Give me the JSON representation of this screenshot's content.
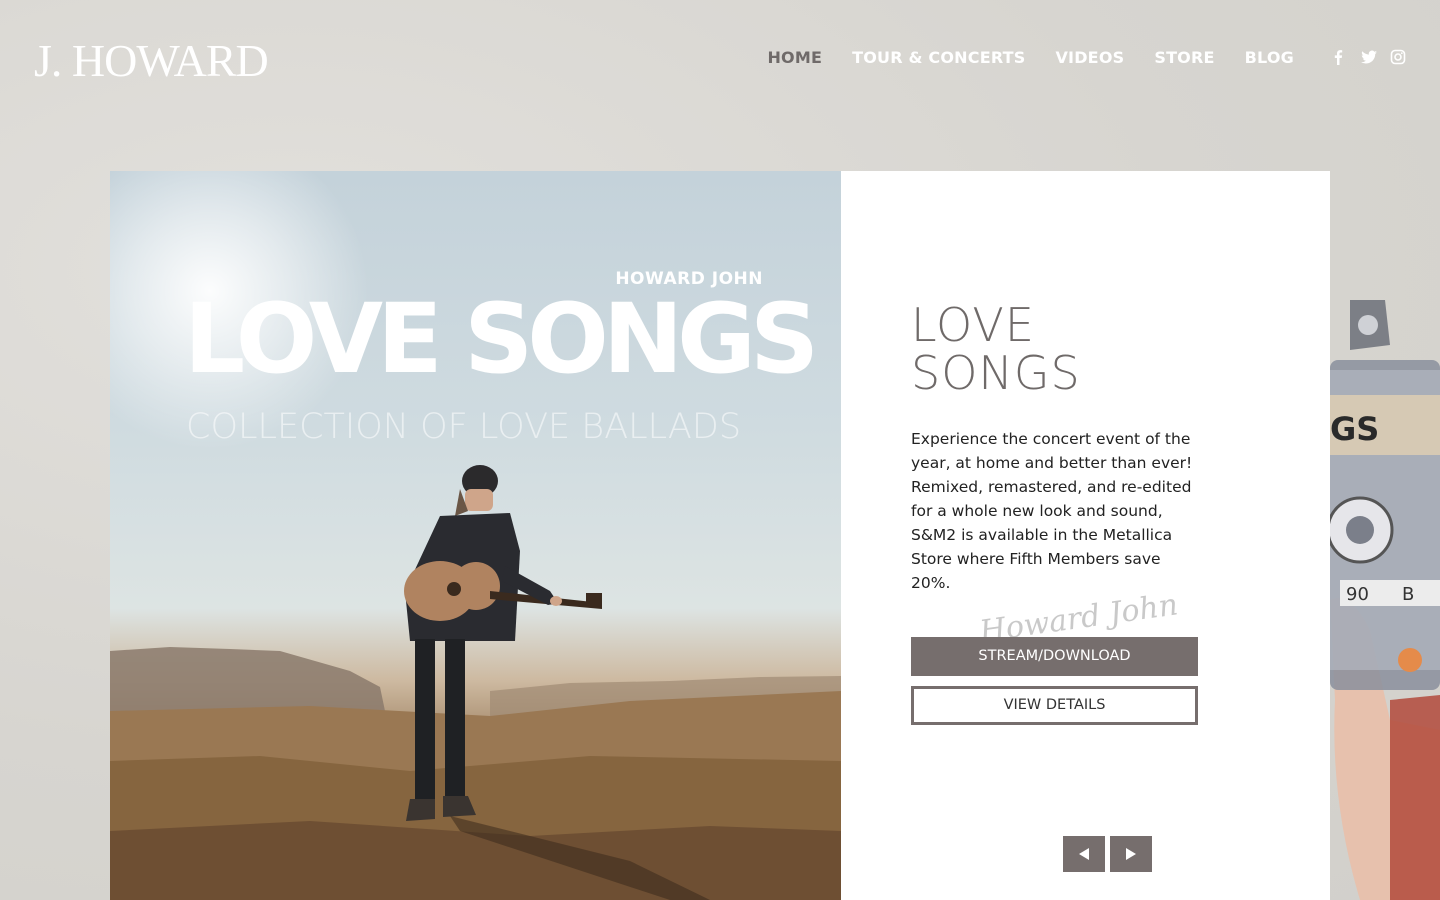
{
  "header": {
    "logo": "J. HOWARD",
    "nav": [
      {
        "label": "HOME",
        "active": true
      },
      {
        "label": "TOUR & CONCERTS",
        "active": false
      },
      {
        "label": "VIDEOS",
        "active": false
      },
      {
        "label": "STORE",
        "active": false
      },
      {
        "label": "BLOG",
        "active": false
      }
    ],
    "social_icons": [
      "facebook-icon",
      "twitter-icon",
      "instagram-icon"
    ]
  },
  "album_art": {
    "artist": "HOWARD JOHN",
    "title": "LOVE SONGS",
    "subtitle": "COLLECTION OF LOVE BALLADS"
  },
  "card": {
    "title_line1": "LOVE",
    "title_line2": "SONGS",
    "description": "Experience the concert event of the year, at home and better than ever! Remixed, remastered, and re-edited for a whole new look and sound, S&M2 is available in the Metallica Store where Fifth Members save 20%.",
    "signature": "Howard John",
    "primary_button": "STREAM/DOWNLOAD",
    "secondary_button": "VIEW DETAILS",
    "prev_icon": "arrow-left-icon",
    "next_icon": "arrow-right-icon"
  },
  "colors": {
    "background": "#d8d6d1",
    "accent": "#766e6d",
    "nav_active": "#6f6a69"
  }
}
